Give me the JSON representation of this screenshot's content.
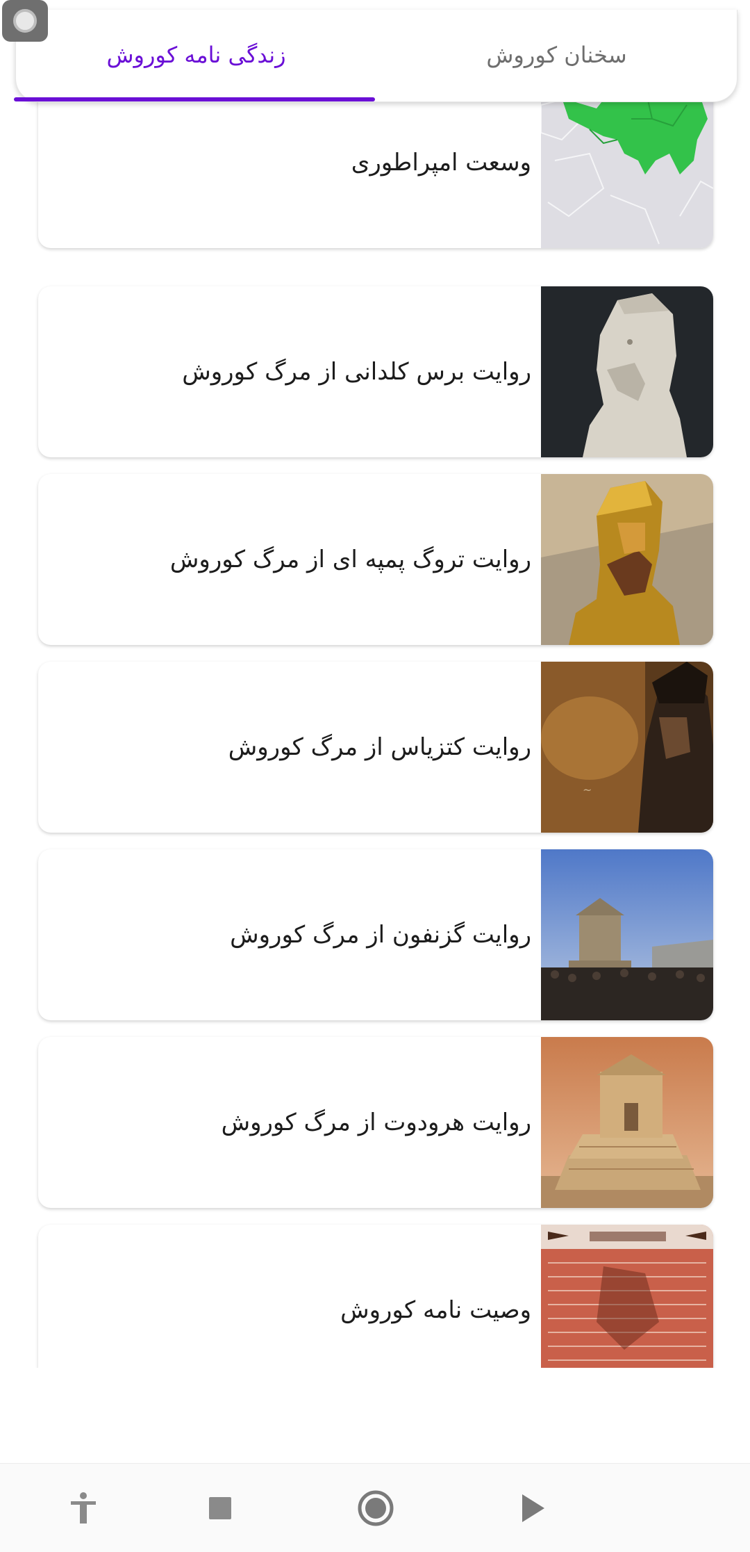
{
  "tabs": {
    "active_label": "زندگی نامه کوروش",
    "other_label": "سخنان کوروش"
  },
  "items": [
    {
      "title": "وسعت امپراطوری",
      "thumb": "map-image"
    },
    {
      "title": "روایت برس کلدانی از مرگ کوروش",
      "thumb": "relief-portrait-image"
    },
    {
      "title": "روایت تروگ پمپه ای از مرگ کوروش",
      "thumb": "golden-statue-image"
    },
    {
      "title": "روایت کتزیاس از مرگ کوروش",
      "thumb": "painting-image"
    },
    {
      "title": "روایت گزنفون از مرگ کوروش",
      "thumb": "tomb-crowd-image"
    },
    {
      "title": "روایت هرودوت از مرگ کوروش",
      "thumb": "tomb-image"
    },
    {
      "title": "وصیت نامه کوروش",
      "thumb": "manuscript-image"
    }
  ],
  "nav": {
    "icons": [
      "accessibility-icon",
      "stop-icon",
      "home-icon",
      "back-icon"
    ]
  },
  "colors": {
    "accent": "#6a0fd6"
  }
}
